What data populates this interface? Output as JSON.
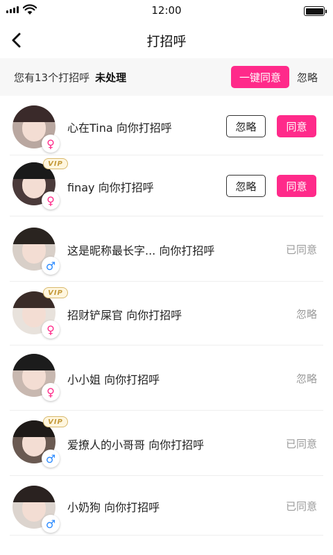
{
  "status_bar": {
    "time": "12:00"
  },
  "nav": {
    "title": "打招呼"
  },
  "summary": {
    "text": "您有13个打招呼",
    "status": "未处理",
    "accept_all_label": "一键同意",
    "ignore_all_label": "忽略"
  },
  "colors": {
    "accent": "#ff2a8a",
    "male": "#2a8aff",
    "vip_gold": "#c49a3a"
  },
  "items": [
    {
      "text": "心在Tina 向你打招呼",
      "gender": "female",
      "vip": false,
      "ignore_label": "忽略",
      "accept_label": "同意",
      "status": "",
      "avatar_hair": "#3a2a2a",
      "avatar_bg": "#b9a7a0"
    },
    {
      "text": "finay 向你打招呼",
      "gender": "female",
      "vip": true,
      "vip_label": "VIP",
      "ignore_label": "忽略",
      "accept_label": "同意",
      "status": "",
      "avatar_hair": "#1a1a1a",
      "avatar_bg": "#4a3a3a"
    },
    {
      "text": "这是昵称最长字... 向你打招呼",
      "gender": "male",
      "vip": false,
      "status": "已同意",
      "avatar_hair": "#2a2420",
      "avatar_bg": "#d8cfc8"
    },
    {
      "text": "招财铲屎官 向你打招呼",
      "gender": "female",
      "vip": true,
      "vip_label": "VIP",
      "status": "忽略",
      "avatar_hair": "#3a2c28",
      "avatar_bg": "#e8e2dc"
    },
    {
      "text": "小小姐 向你打招呼",
      "gender": "female",
      "vip": false,
      "status": "忽略",
      "avatar_hair": "#1c1c1c",
      "avatar_bg": "#c8b8b0"
    },
    {
      "text": "爱撩人的小哥哥 向你打招呼",
      "gender": "male",
      "vip": true,
      "vip_label": "VIP",
      "status": "已同意",
      "avatar_hair": "#1e1a18",
      "avatar_bg": "#6a5a52"
    },
    {
      "text": "小奶狗 向你打招呼",
      "gender": "male",
      "vip": false,
      "status": "已同意",
      "avatar_hair": "#2a2220",
      "avatar_bg": "#dcd4ce"
    }
  ]
}
